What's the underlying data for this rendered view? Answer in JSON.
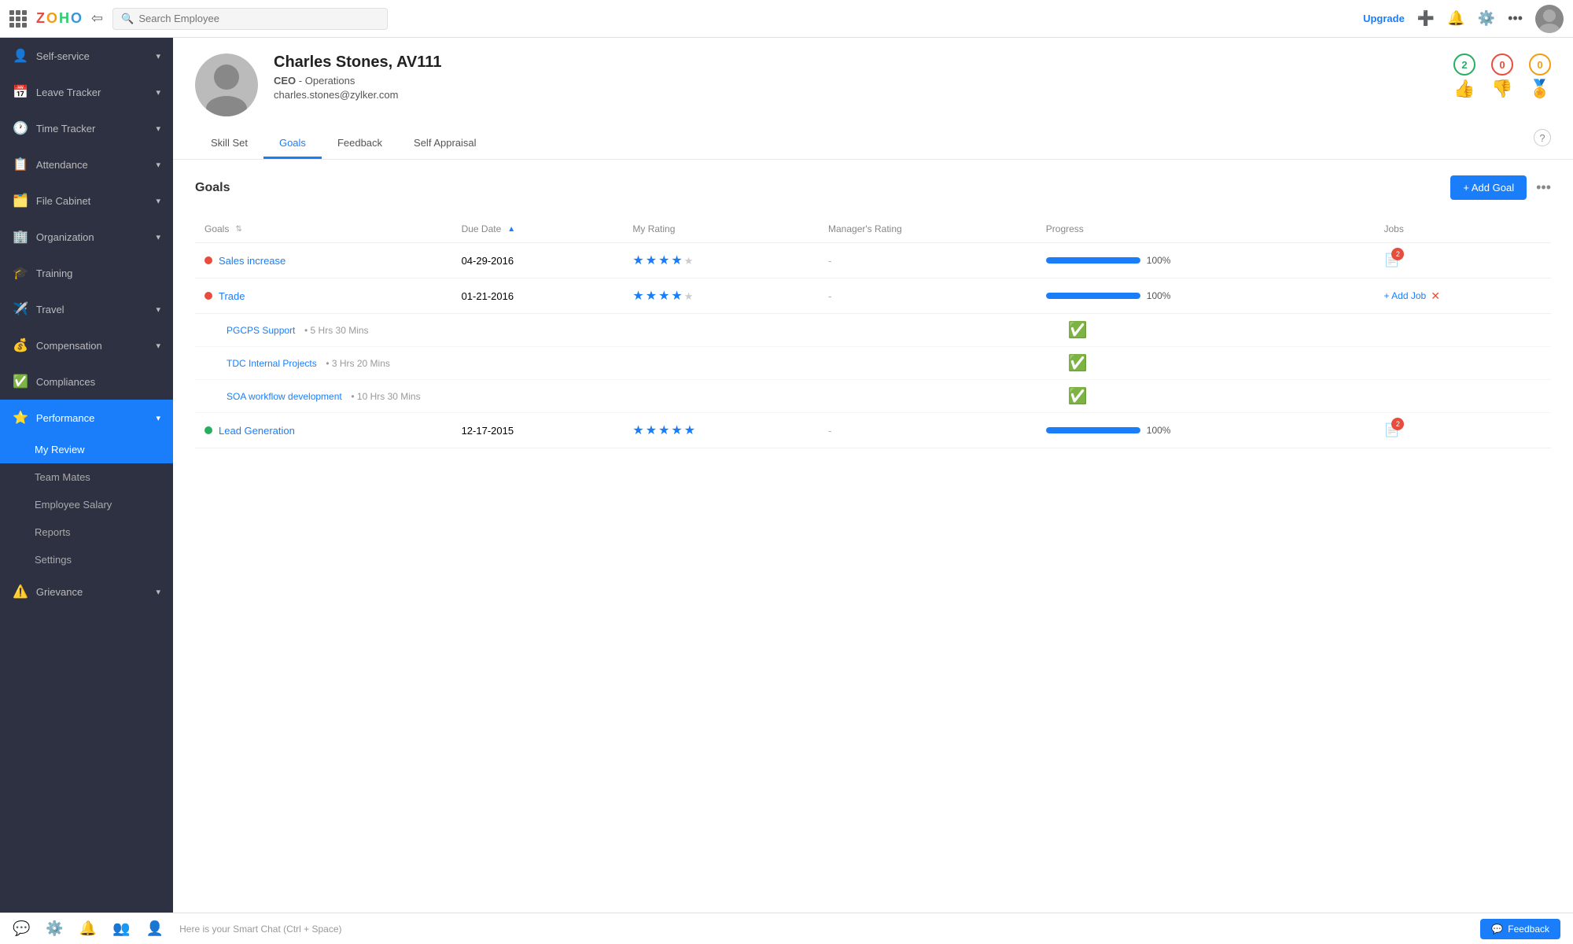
{
  "topbar": {
    "search_placeholder": "Search Employee",
    "upgrade_label": "Upgrade",
    "logo": "ZOHO"
  },
  "sidebar": {
    "items": [
      {
        "id": "self-service",
        "label": "Self-service",
        "icon": "👤",
        "hasChevron": true
      },
      {
        "id": "leave-tracker",
        "label": "Leave Tracker",
        "icon": "📅",
        "hasChevron": true
      },
      {
        "id": "time-tracker",
        "label": "Time Tracker",
        "icon": "🕐",
        "hasChevron": true
      },
      {
        "id": "attendance",
        "label": "Attendance",
        "icon": "📋",
        "hasChevron": true
      },
      {
        "id": "file-cabinet",
        "label": "File Cabinet",
        "icon": "🗂️",
        "hasChevron": true
      },
      {
        "id": "organization",
        "label": "Organization",
        "icon": "🏢",
        "hasChevron": true
      },
      {
        "id": "training",
        "label": "Training",
        "icon": "🎓",
        "hasChevron": false
      },
      {
        "id": "travel",
        "label": "Travel",
        "icon": "✈️",
        "hasChevron": true
      },
      {
        "id": "compensation",
        "label": "Compensation",
        "icon": "💰",
        "hasChevron": true
      },
      {
        "id": "compliances",
        "label": "Compliances",
        "icon": "✅",
        "hasChevron": false
      },
      {
        "id": "performance",
        "label": "Performance",
        "icon": "⭐",
        "hasChevron": true,
        "active": true
      },
      {
        "id": "team-mates",
        "label": "Team Mates",
        "subItem": true
      },
      {
        "id": "my-review",
        "label": "My Review",
        "subItem": true,
        "active": true
      },
      {
        "id": "employee-salary",
        "label": "Employee Salary",
        "subItem": true
      },
      {
        "id": "reports",
        "label": "Reports",
        "subItem": true
      },
      {
        "id": "settings",
        "label": "Settings",
        "subItem": true
      },
      {
        "id": "grievance",
        "label": "Grievance",
        "icon": "⚠️",
        "hasChevron": true
      }
    ]
  },
  "profile": {
    "name": "Charles Stones, AV111",
    "title": "CEO",
    "department": "Operations",
    "email": "charles.stones@zylker.com",
    "badges": {
      "thumbs_up": {
        "count": "2",
        "icon": "👍"
      },
      "thumbs_down": {
        "count": "0",
        "icon": "👎"
      },
      "award": {
        "count": "0",
        "icon": "🏅"
      }
    },
    "tabs": [
      "Skill Set",
      "Goals",
      "Feedback",
      "Self Appraisal"
    ]
  },
  "goals": {
    "title": "Goals",
    "add_button": "+ Add Goal",
    "columns": [
      "Goals",
      "Due Date",
      "My Rating",
      "Manager's Rating",
      "Progress",
      "Jobs"
    ],
    "rows": [
      {
        "name": "Sales increase",
        "status": "red",
        "due_date": "04-29-2016",
        "my_rating": 4,
        "managers_rating": "-",
        "progress": 100,
        "jobs_count": 2,
        "sub_goals": []
      },
      {
        "name": "Trade",
        "status": "red",
        "due_date": "01-21-2016",
        "my_rating": 4,
        "managers_rating": "-",
        "progress": 100,
        "jobs_count": 0,
        "add_job": true,
        "sub_goals": [
          {
            "name": "PGCPS Support",
            "time": "5 Hrs 30 Mins",
            "done": true
          },
          {
            "name": "TDC Internal Projects",
            "time": "3 Hrs 20 Mins",
            "done": true
          },
          {
            "name": "SOA workflow development",
            "time": "10 Hrs 30 Mins",
            "done": true
          }
        ]
      },
      {
        "name": "Lead Generation",
        "status": "green",
        "due_date": "12-17-2015",
        "my_rating": 5,
        "managers_rating": "-",
        "progress": 100,
        "jobs_count": 2,
        "sub_goals": []
      }
    ]
  },
  "bottombar": {
    "smart_chat": "Here is your Smart Chat (Ctrl + Space)",
    "feedback_label": "Feedback"
  }
}
